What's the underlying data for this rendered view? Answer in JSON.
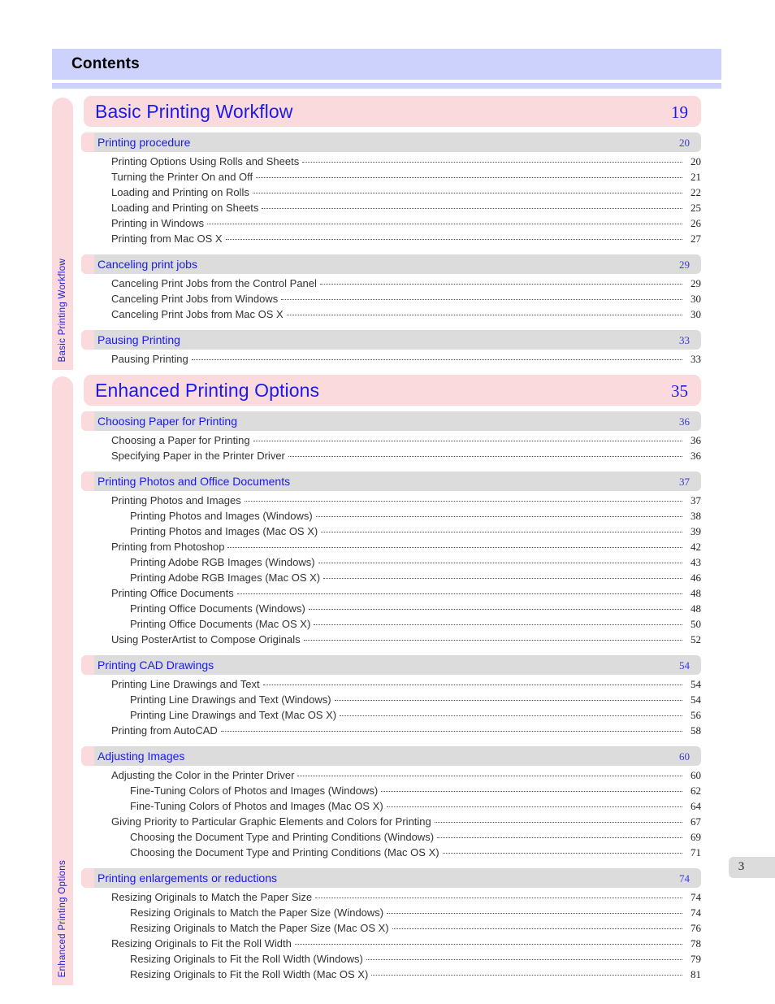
{
  "header": {
    "title": "Contents"
  },
  "page_badge": {
    "number": "3"
  },
  "colors": {
    "header_band": "#ccd2fb",
    "chapter_bar": "#fadadd",
    "section_bar": "#dcdcdc",
    "section_cap": "#fadadd",
    "link_blue": "#1a1aee",
    "entry_text": "#333333"
  },
  "chapters": [
    {
      "side_tab": "Basic Printing Workflow",
      "title": "Basic Printing Workflow",
      "page": "19",
      "sections": [
        {
          "title": "Printing procedure",
          "page": "20",
          "entries": [
            {
              "level": 1,
              "text": "Printing Options Using Rolls and Sheets",
              "page": "20"
            },
            {
              "level": 1,
              "text": "Turning the Printer On and Off",
              "page": "21"
            },
            {
              "level": 1,
              "text": "Loading and Printing on Rolls",
              "page": "22"
            },
            {
              "level": 1,
              "text": "Loading and Printing on Sheets",
              "page": "25"
            },
            {
              "level": 1,
              "text": "Printing in Windows",
              "page": "26"
            },
            {
              "level": 1,
              "text": "Printing from Mac OS X",
              "page": "27"
            }
          ]
        },
        {
          "title": "Canceling print jobs",
          "page": "29",
          "entries": [
            {
              "level": 1,
              "text": "Canceling Print Jobs from the Control Panel",
              "page": "29"
            },
            {
              "level": 1,
              "text": "Canceling Print Jobs from Windows",
              "page": "30"
            },
            {
              "level": 1,
              "text": "Canceling Print Jobs from Mac OS X",
              "page": "30"
            }
          ]
        },
        {
          "title": "Pausing Printing",
          "page": "33",
          "entries": [
            {
              "level": 1,
              "text": "Pausing Printing",
              "page": "33"
            }
          ]
        }
      ]
    },
    {
      "side_tab": "Enhanced Printing Options",
      "title": "Enhanced Printing Options",
      "page": "35",
      "sections": [
        {
          "title": "Choosing Paper for Printing",
          "page": "36",
          "entries": [
            {
              "level": 1,
              "text": "Choosing a Paper for Printing",
              "page": "36"
            },
            {
              "level": 1,
              "text": "Specifying Paper in the Printer Driver",
              "page": "36"
            }
          ]
        },
        {
          "title": "Printing Photos and Office Documents",
          "page": "37",
          "entries": [
            {
              "level": 1,
              "text": "Printing Photos and Images",
              "page": "37"
            },
            {
              "level": 2,
              "text": "Printing Photos and Images (Windows)",
              "page": "38"
            },
            {
              "level": 2,
              "text": "Printing Photos and Images (Mac OS X)",
              "page": "39"
            },
            {
              "level": 1,
              "text": "Printing from Photoshop",
              "page": "42"
            },
            {
              "level": 2,
              "text": "Printing Adobe RGB Images (Windows)",
              "page": "43"
            },
            {
              "level": 2,
              "text": "Printing Adobe RGB Images (Mac OS X)",
              "page": "46"
            },
            {
              "level": 1,
              "text": "Printing Office Documents",
              "page": "48"
            },
            {
              "level": 2,
              "text": "Printing Office Documents (Windows)",
              "page": "48"
            },
            {
              "level": 2,
              "text": "Printing Office Documents (Mac OS X)",
              "page": "50"
            },
            {
              "level": 1,
              "text": "Using PosterArtist to Compose Originals",
              "page": "52"
            }
          ]
        },
        {
          "title": "Printing CAD Drawings",
          "page": "54",
          "entries": [
            {
              "level": 1,
              "text": "Printing Line Drawings and Text",
              "page": "54"
            },
            {
              "level": 2,
              "text": "Printing Line Drawings and Text (Windows)",
              "page": "54"
            },
            {
              "level": 2,
              "text": "Printing Line Drawings and Text (Mac OS X)",
              "page": "56"
            },
            {
              "level": 1,
              "text": "Printing from AutoCAD",
              "page": "58"
            }
          ]
        },
        {
          "title": "Adjusting Images",
          "page": "60",
          "entries": [
            {
              "level": 1,
              "text": "Adjusting the Color in the Printer Driver",
              "page": "60"
            },
            {
              "level": 2,
              "text": "Fine-Tuning Colors of Photos and Images (Windows)",
              "page": "62"
            },
            {
              "level": 2,
              "text": "Fine-Tuning Colors of Photos and Images (Mac OS X)",
              "page": "64"
            },
            {
              "level": 1,
              "text": "Giving Priority to Particular Graphic Elements and Colors for Printing",
              "page": "67"
            },
            {
              "level": 2,
              "text": "Choosing the Document Type and Printing Conditions (Windows)",
              "page": "69"
            },
            {
              "level": 2,
              "text": "Choosing the Document Type and Printing Conditions (Mac OS X)",
              "page": "71"
            }
          ]
        },
        {
          "title": "Printing enlargements or reductions",
          "page": "74",
          "entries": [
            {
              "level": 1,
              "text": "Resizing Originals to Match the Paper Size",
              "page": "74"
            },
            {
              "level": 2,
              "text": "Resizing Originals to Match the Paper Size (Windows)",
              "page": "74"
            },
            {
              "level": 2,
              "text": "Resizing Originals to Match the Paper Size (Mac OS X)",
              "page": "76"
            },
            {
              "level": 1,
              "text": "Resizing Originals to Fit the Roll Width",
              "page": "78"
            },
            {
              "level": 2,
              "text": "Resizing Originals to Fit the Roll Width (Windows)",
              "page": "79"
            },
            {
              "level": 2,
              "text": "Resizing Originals to Fit the Roll Width (Mac OS X)",
              "page": "81"
            }
          ]
        }
      ]
    }
  ]
}
